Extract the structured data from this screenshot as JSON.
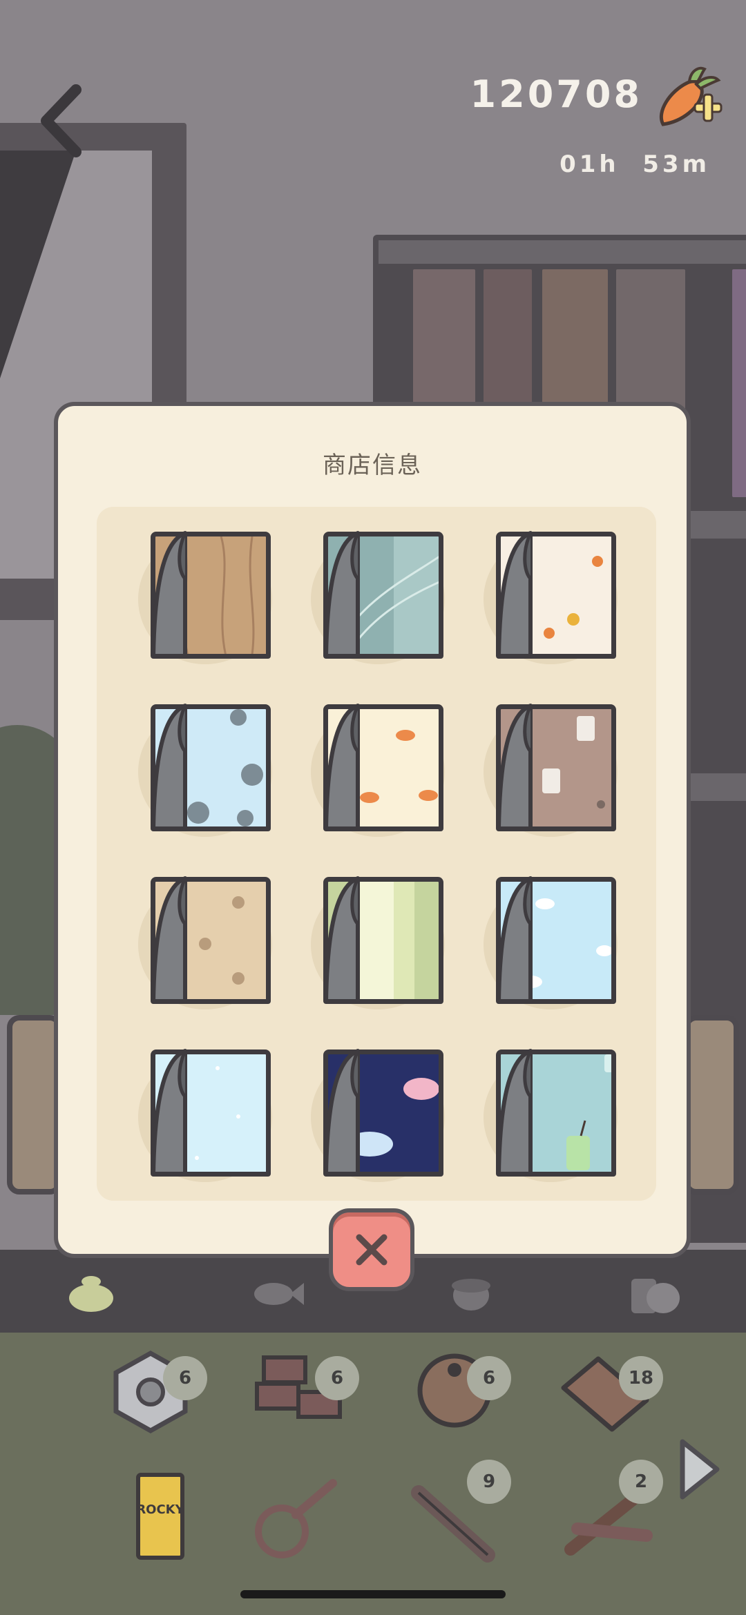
{
  "header": {
    "currency_amount": "120708",
    "timer": "01h  53m",
    "back_icon": "chevron-left-icon",
    "currency_icon": "carrot-plus-icon"
  },
  "modal": {
    "title": "商店信息",
    "close_icon": "close-icon",
    "items": [
      {
        "name": "wood-grain-wallpaper",
        "color": "#c7a27a"
      },
      {
        "name": "teal-leaf-wallpaper",
        "color": "#8fb1b0"
      },
      {
        "name": "autumn-leaves-wallpaper",
        "color": "#f8efe3"
      },
      {
        "name": "blue-butterfly-wallpaper",
        "color": "#cfeaf7"
      },
      {
        "name": "carrot-pattern-wallpaper",
        "color": "#faf1d8"
      },
      {
        "name": "coffee-cup-wallpaper",
        "color": "#b3968a"
      },
      {
        "name": "paw-print-wallpaper",
        "color": "#e5cfad"
      },
      {
        "name": "green-stripe-wallpaper",
        "color": "#c5d49e"
      },
      {
        "name": "sky-cloud-wallpaper",
        "color": "#c8eaf8"
      },
      {
        "name": "light-blue-sparkle-wallpaper",
        "color": "#d6f1fa"
      },
      {
        "name": "night-cloud-wallpaper",
        "color": "#283068"
      },
      {
        "name": "bubble-tea-wallpaper",
        "color": "#a9d4d7"
      }
    ]
  },
  "tabs": [
    {
      "name": "bag-tab",
      "icon": "sack-icon",
      "active": true
    },
    {
      "name": "fish-tab",
      "icon": "fish-icon",
      "active": false
    },
    {
      "name": "acorn-tab",
      "icon": "acorn-icon",
      "active": false
    },
    {
      "name": "food-tab",
      "icon": "food-icon",
      "active": false
    }
  ],
  "inventory": [
    {
      "name": "hex-nut",
      "icon": "hex-nut-icon",
      "count": "6"
    },
    {
      "name": "bricks",
      "icon": "bricks-icon",
      "count": "6"
    },
    {
      "name": "coconut",
      "icon": "coconut-icon",
      "count": "6"
    },
    {
      "name": "wood-plank",
      "icon": "wood-plank-icon",
      "count": "18"
    },
    {
      "name": "rocky-snack",
      "icon": "rocky-box-icon",
      "label": "ROCKY",
      "count": ""
    },
    {
      "name": "rope",
      "icon": "rope-icon",
      "count": ""
    },
    {
      "name": "bamboo",
      "icon": "bamboo-icon",
      "count": "9"
    },
    {
      "name": "firewood",
      "icon": "firewood-icon",
      "count": "2"
    }
  ],
  "next_icon": "arrow-right-icon"
}
